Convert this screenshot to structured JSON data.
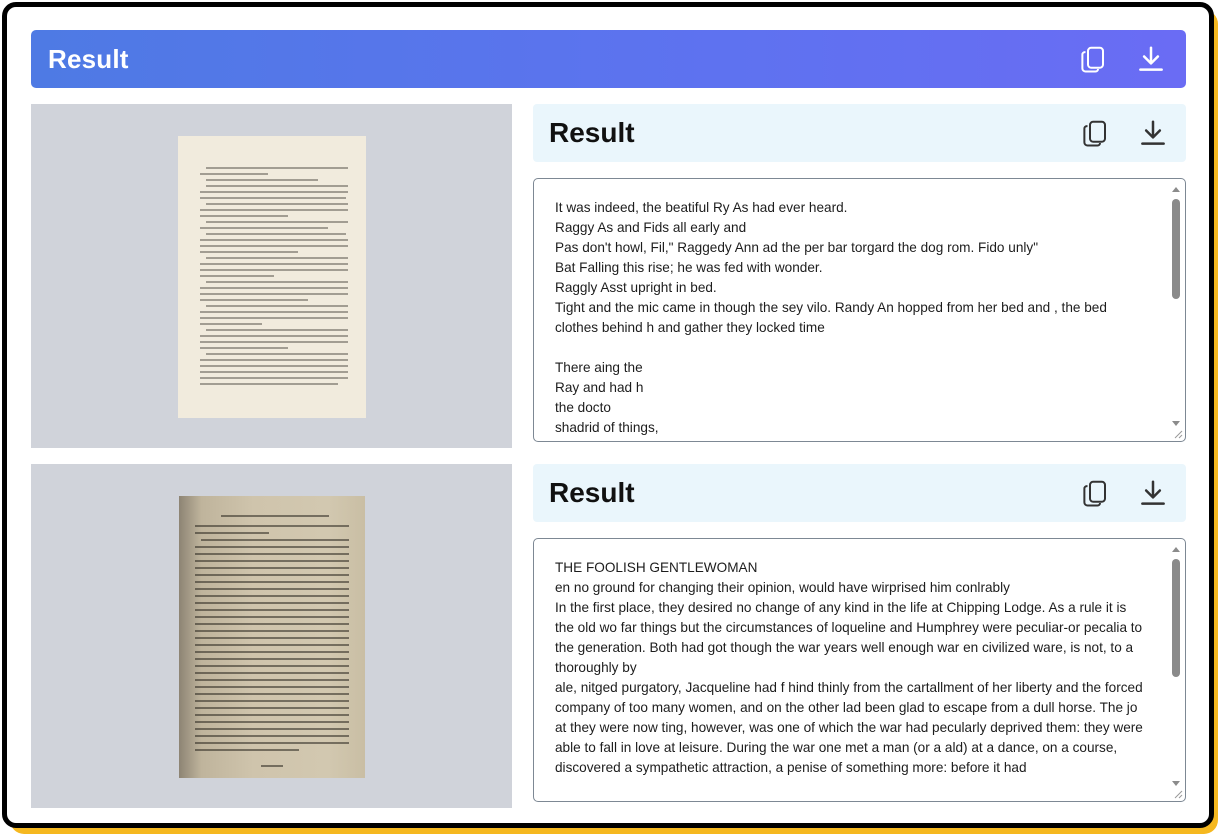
{
  "header": {
    "title": "Result",
    "copy_icon": "copy-icon",
    "download_icon": "download-icon"
  },
  "colors": {
    "header_gradient_start": "#4e7ae4",
    "header_gradient_end": "#6a6cf4",
    "result_header_bg": "#eaf6fc",
    "image_panel_bg": "#d0d3da",
    "frame_accent": "#f5b820"
  },
  "results": [
    {
      "title": "Result",
      "copy_icon": "copy-icon",
      "download_icon": "download-icon",
      "text": "It was indeed, the beatiful Ry As had ever heard.\nRaggy As and Fids all early and\nPas don't howl, Fil,\" Raggedy Ann ad the per bar torgard the dog rom. Fido unly\"\nBat Falling this rise; he was fed with wonder.\nRaggly Asst upright in bed.\nTight and the mic came in though the sey vilo. Randy An hopped from her bed and , the bed clothes behind h and gather they locked time\n\nThere aing the\nRay and had h\nthe docto\nshadrid of things,"
    },
    {
      "title": "Result",
      "copy_icon": "copy-icon",
      "download_icon": "download-icon",
      "text": "THE FOOLISH GENTLEWOMAN\nen no ground for changing their opinion, would have wirprised him conlrably\nIn the first place, they desired no change of any kind in the life at Chipping Lodge. As a rule it is the old wo far things but the circumstances of loqueline and Humphrey were peculiar-or pecalia to the generation. Both had got though the war years well enough war en civilized ware, is not, to a thoroughly by\nale, nitged purgatory, Jacqueline had f hind thinly from the cartallment of her liberty and the forced company of too many women, and on the other lad been glad to escape from a dull horse. The jo at they were now ting, however, was one of which the war had pecularly deprived them: they were able to fall in love at leisure. During the war one met a man (or a ald) at a dance, on a course, discovered a sympathetic attraction, a penise of something more: before it had"
    }
  ]
}
